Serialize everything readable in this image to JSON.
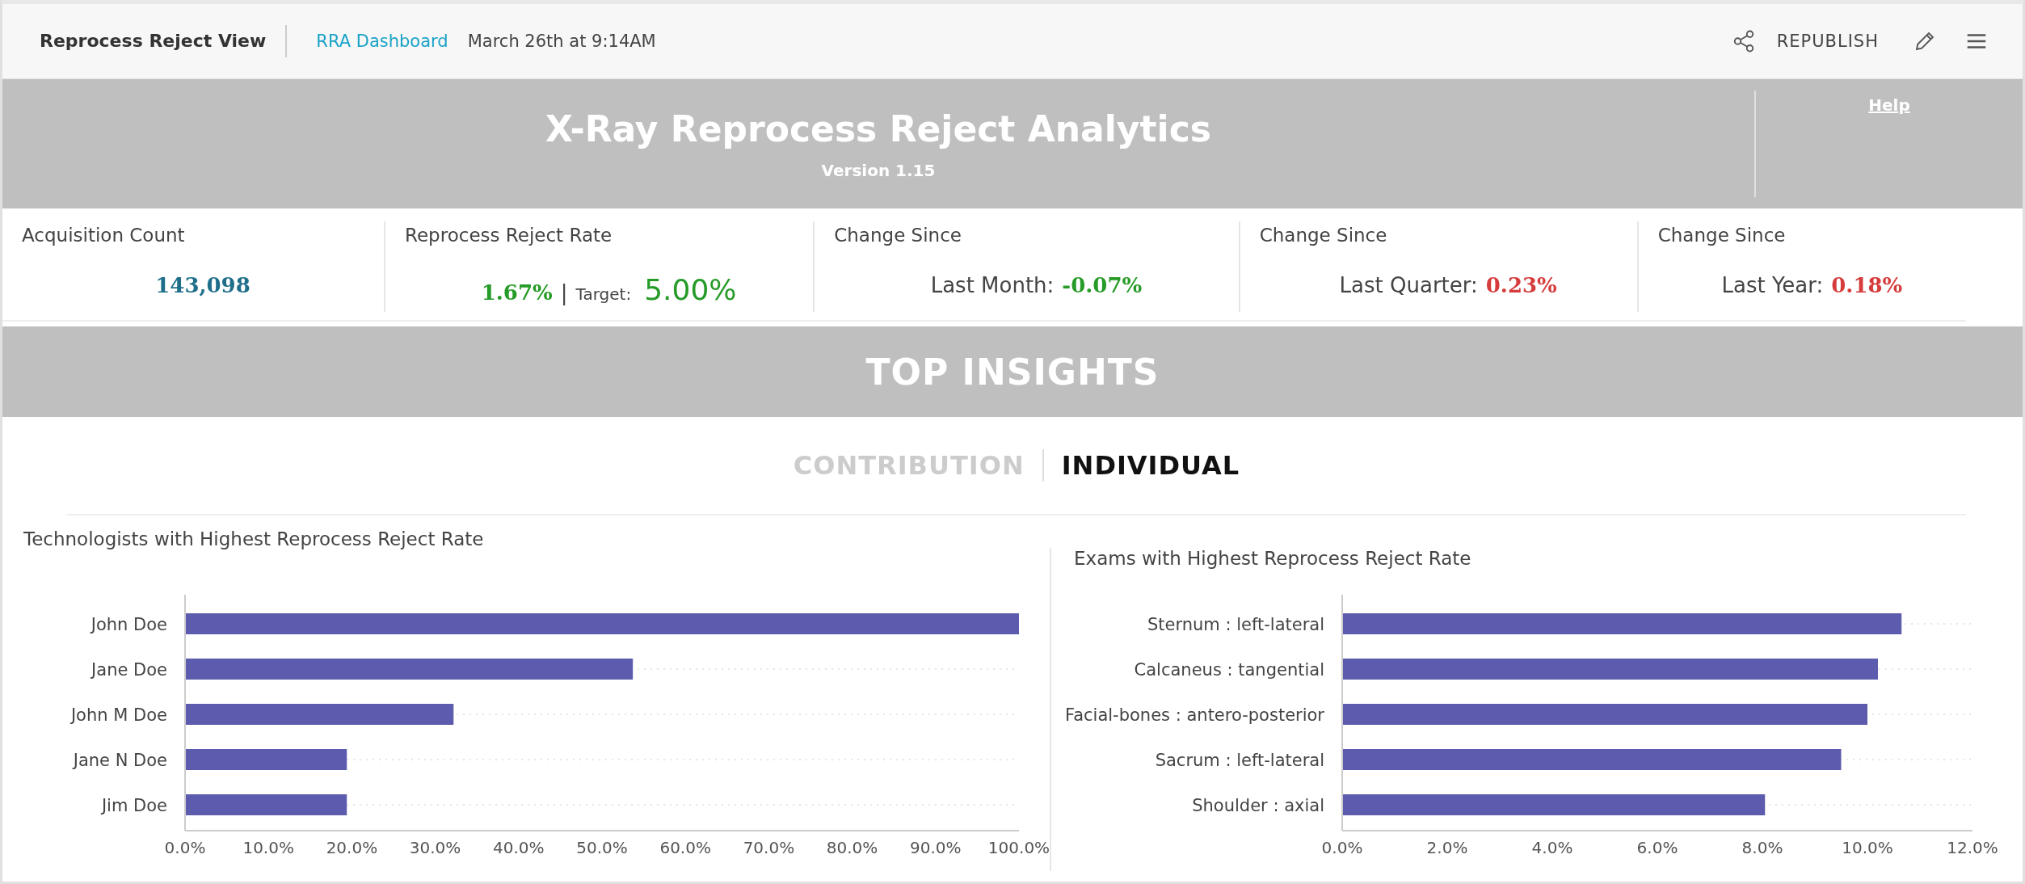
{
  "header": {
    "title": "Reprocess Reject View",
    "link": "RRA Dashboard",
    "timestamp": "March 26th at 9:14AM",
    "republish": "REPUBLISH"
  },
  "banner": {
    "title": "X-Ray Reprocess Reject Analytics",
    "version": "Version 1.15",
    "help": "Help"
  },
  "kpis": [
    {
      "kind": "plain",
      "label": "Acquisition Count",
      "value": "143,098",
      "color": "#1f6f8b"
    },
    {
      "kind": "target",
      "label": "Reprocess Reject Rate",
      "value": "1.67%",
      "color": "#279b28",
      "separator": "|",
      "target_label": "Target:",
      "target_value": "5.00%"
    },
    {
      "kind": "change",
      "label": "Change Since",
      "prefix": "Last Month:",
      "value": "-0.07%",
      "color": "#279b28"
    },
    {
      "kind": "change",
      "label": "Change Since",
      "prefix": "Last Quarter:",
      "value": "0.23%",
      "color": "#d63c3c"
    },
    {
      "kind": "change",
      "label": "Change Since",
      "prefix": "Last Year:",
      "value": "0.18%",
      "color": "#d63c3c"
    }
  ],
  "insights": {
    "title": "TOP INSIGHTS",
    "tabs": [
      {
        "label": "CONTRIBUTION",
        "selected": false
      },
      {
        "label": "INDIVIDUAL",
        "selected": true
      }
    ],
    "charts": [
      {
        "title": "Technologists with Highest Reprocess Reject Rate",
        "chart_data": {
          "type": "bar",
          "orientation": "horizontal",
          "categories": [
            "John Doe",
            "Jane Doe",
            "John M Doe",
            "Jane N Doe",
            "Jim Doe"
          ],
          "series": [
            {
              "color": "#5d5bad",
              "values": [
                100,
                53.7,
                32.2,
                19.4,
                19.4
              ]
            }
          ],
          "xlim": [
            0,
            100
          ],
          "xticks": [
            {
              "value": 0,
              "label": "0.0%"
            },
            {
              "value": 10,
              "label": "10.0%"
            },
            {
              "value": 20,
              "label": "20.0%"
            },
            {
              "value": 30,
              "label": "30.0%"
            },
            {
              "value": 40,
              "label": "40.0%"
            },
            {
              "value": 50,
              "label": "50.0%"
            },
            {
              "value": 60,
              "label": "60.0%"
            },
            {
              "value": 70,
              "label": "70.0%"
            },
            {
              "value": 80,
              "label": "80.0%"
            },
            {
              "value": 90,
              "label": "90.0%"
            },
            {
              "value": 100,
              "label": "100.0%"
            }
          ]
        }
      },
      {
        "title": "Exams with Highest Reprocess Reject Rate",
        "chart_data": {
          "type": "bar",
          "orientation": "horizontal",
          "categories": [
            "Sternum : left-lateral",
            "Calcaneus : tangential",
            "Facial-bones : antero-posterior",
            "Sacrum : left-lateral",
            "Shoulder : axial"
          ],
          "series": [
            {
              "color": "#5d5bad",
              "values": [
                10.65,
                10.2,
                10.0,
                9.5,
                8.05
              ]
            }
          ],
          "xlim": [
            0,
            12
          ],
          "xticks": [
            {
              "value": 0,
              "label": "0.0%"
            },
            {
              "value": 2,
              "label": "2.0%"
            },
            {
              "value": 4,
              "label": "4.0%"
            },
            {
              "value": 6,
              "label": "6.0%"
            },
            {
              "value": 8,
              "label": "8.0%"
            },
            {
              "value": 10,
              "label": "10.0%"
            },
            {
              "value": 12,
              "label": "12.0%"
            }
          ]
        }
      }
    ]
  }
}
